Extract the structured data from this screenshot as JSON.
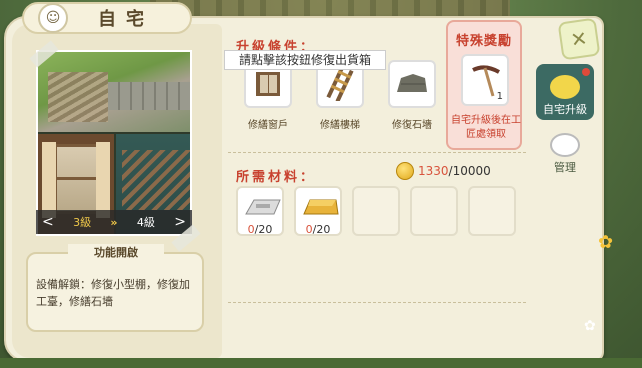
{
  "title": "自宅",
  "photo": {
    "current_level": "3級",
    "next_level": "4級",
    "arrows": "»"
  },
  "feature": {
    "title": "功能開啟",
    "text": "設備解鎖：修復小型棚，修復加工臺，修繕石墻"
  },
  "conditions": {
    "title": "升級條件：",
    "hint": "請點擊該按鈕修復出貨箱",
    "items": [
      {
        "label": "修繕窗戶",
        "icon": "window-icon"
      },
      {
        "label": "修繕樓梯",
        "icon": "stairs-icon"
      },
      {
        "label": "修復石墻",
        "icon": "stone-wall-icon"
      }
    ]
  },
  "reward": {
    "title": "特殊獎勵",
    "count": "1",
    "icon": "pickaxe-icon",
    "desc": "自宅升級後在工匠處領取"
  },
  "materials": {
    "title": "所需材料：",
    "coin_have": "1330",
    "coin_need": "/10000",
    "items": [
      {
        "have": "0",
        "need": "/20",
        "icon": "silver-ingot-icon"
      },
      {
        "have": "0",
        "need": "/20",
        "icon": "gold-ingot-icon"
      }
    ]
  },
  "side_tabs": [
    {
      "label": "自宅升級",
      "active": true
    },
    {
      "label": "管理",
      "active": false
    }
  ],
  "colors": {
    "accent_red": "#c8422f",
    "panel": "#f3efdc",
    "active_tab": "#3c6a63"
  }
}
